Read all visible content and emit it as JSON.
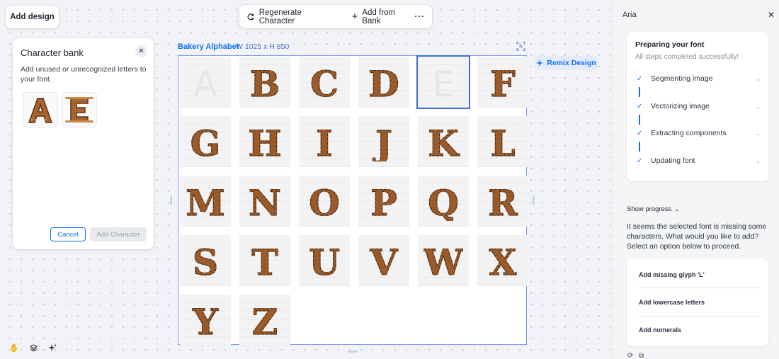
{
  "add_design": "Add design",
  "toolbar": {
    "regenerate_label": "Regenerate Character",
    "add_from_bank_label": "Add from Bank",
    "more_label": "···"
  },
  "character_bank": {
    "title": "Character bank",
    "description": "Add unused or unrecognized letters to your font.",
    "letters": [
      "A",
      "E"
    ],
    "cancel_label": "Cancel",
    "add_label": "Add Character"
  },
  "canvas": {
    "name": "Bakery Alphabet",
    "size": "W 1025 x H 850",
    "glyphs": [
      {
        "letter": "A",
        "state": "missing"
      },
      {
        "letter": "B",
        "state": "filled"
      },
      {
        "letter": "C",
        "state": "filled"
      },
      {
        "letter": "D",
        "state": "filled"
      },
      {
        "letter": "E",
        "state": "selected"
      },
      {
        "letter": "F",
        "state": "filled"
      },
      {
        "letter": "G",
        "state": "filled"
      },
      {
        "letter": "H",
        "state": "filled"
      },
      {
        "letter": "I",
        "state": "filled"
      },
      {
        "letter": "J",
        "state": "filled"
      },
      {
        "letter": "K",
        "state": "filled"
      },
      {
        "letter": "L",
        "state": "filled"
      },
      {
        "letter": "M",
        "state": "filled"
      },
      {
        "letter": "N",
        "state": "filled"
      },
      {
        "letter": "O",
        "state": "filled"
      },
      {
        "letter": "P",
        "state": "filled"
      },
      {
        "letter": "Q",
        "state": "filled"
      },
      {
        "letter": "R",
        "state": "filled"
      },
      {
        "letter": "S",
        "state": "filled"
      },
      {
        "letter": "T",
        "state": "filled"
      },
      {
        "letter": "U",
        "state": "filled"
      },
      {
        "letter": "V",
        "state": "filled"
      },
      {
        "letter": "W",
        "state": "filled"
      },
      {
        "letter": "X",
        "state": "filled"
      },
      {
        "letter": "Y",
        "state": "filled"
      },
      {
        "letter": "Z",
        "state": "filled"
      }
    ]
  },
  "remix_label": "Remix Design",
  "aria": {
    "title": "Aria",
    "prep_title": "Preparing your font",
    "prep_subtitle": "All steps completed successfully!",
    "steps": [
      "Segmenting image",
      "Vectorizing image",
      "Extracting components",
      "Updating font"
    ],
    "show_progress": "Show progress",
    "message": "It seems the selected font is missing some characters. What would you like to add? Select an option below to proceed.",
    "options": [
      "Add missing glyph 'L'",
      "Add lowercase letters",
      "Add numerals"
    ]
  },
  "colors": {
    "accent": "#116dff",
    "bread": "#9b5a2a",
    "bread_light": "#c98a52"
  },
  "icons": {
    "regenerate": "regenerate-icon",
    "add": "plus-icon",
    "close": "close-icon",
    "focus": "focus-icon",
    "remix": "sparkle-icon",
    "hand": "hand-icon",
    "layers": "layers-icon",
    "ai": "ai-sparkle-icon",
    "check": "check-icon",
    "chevron": "chevron-down-icon",
    "refresh": "refresh-icon",
    "copy": "copy-icon"
  }
}
